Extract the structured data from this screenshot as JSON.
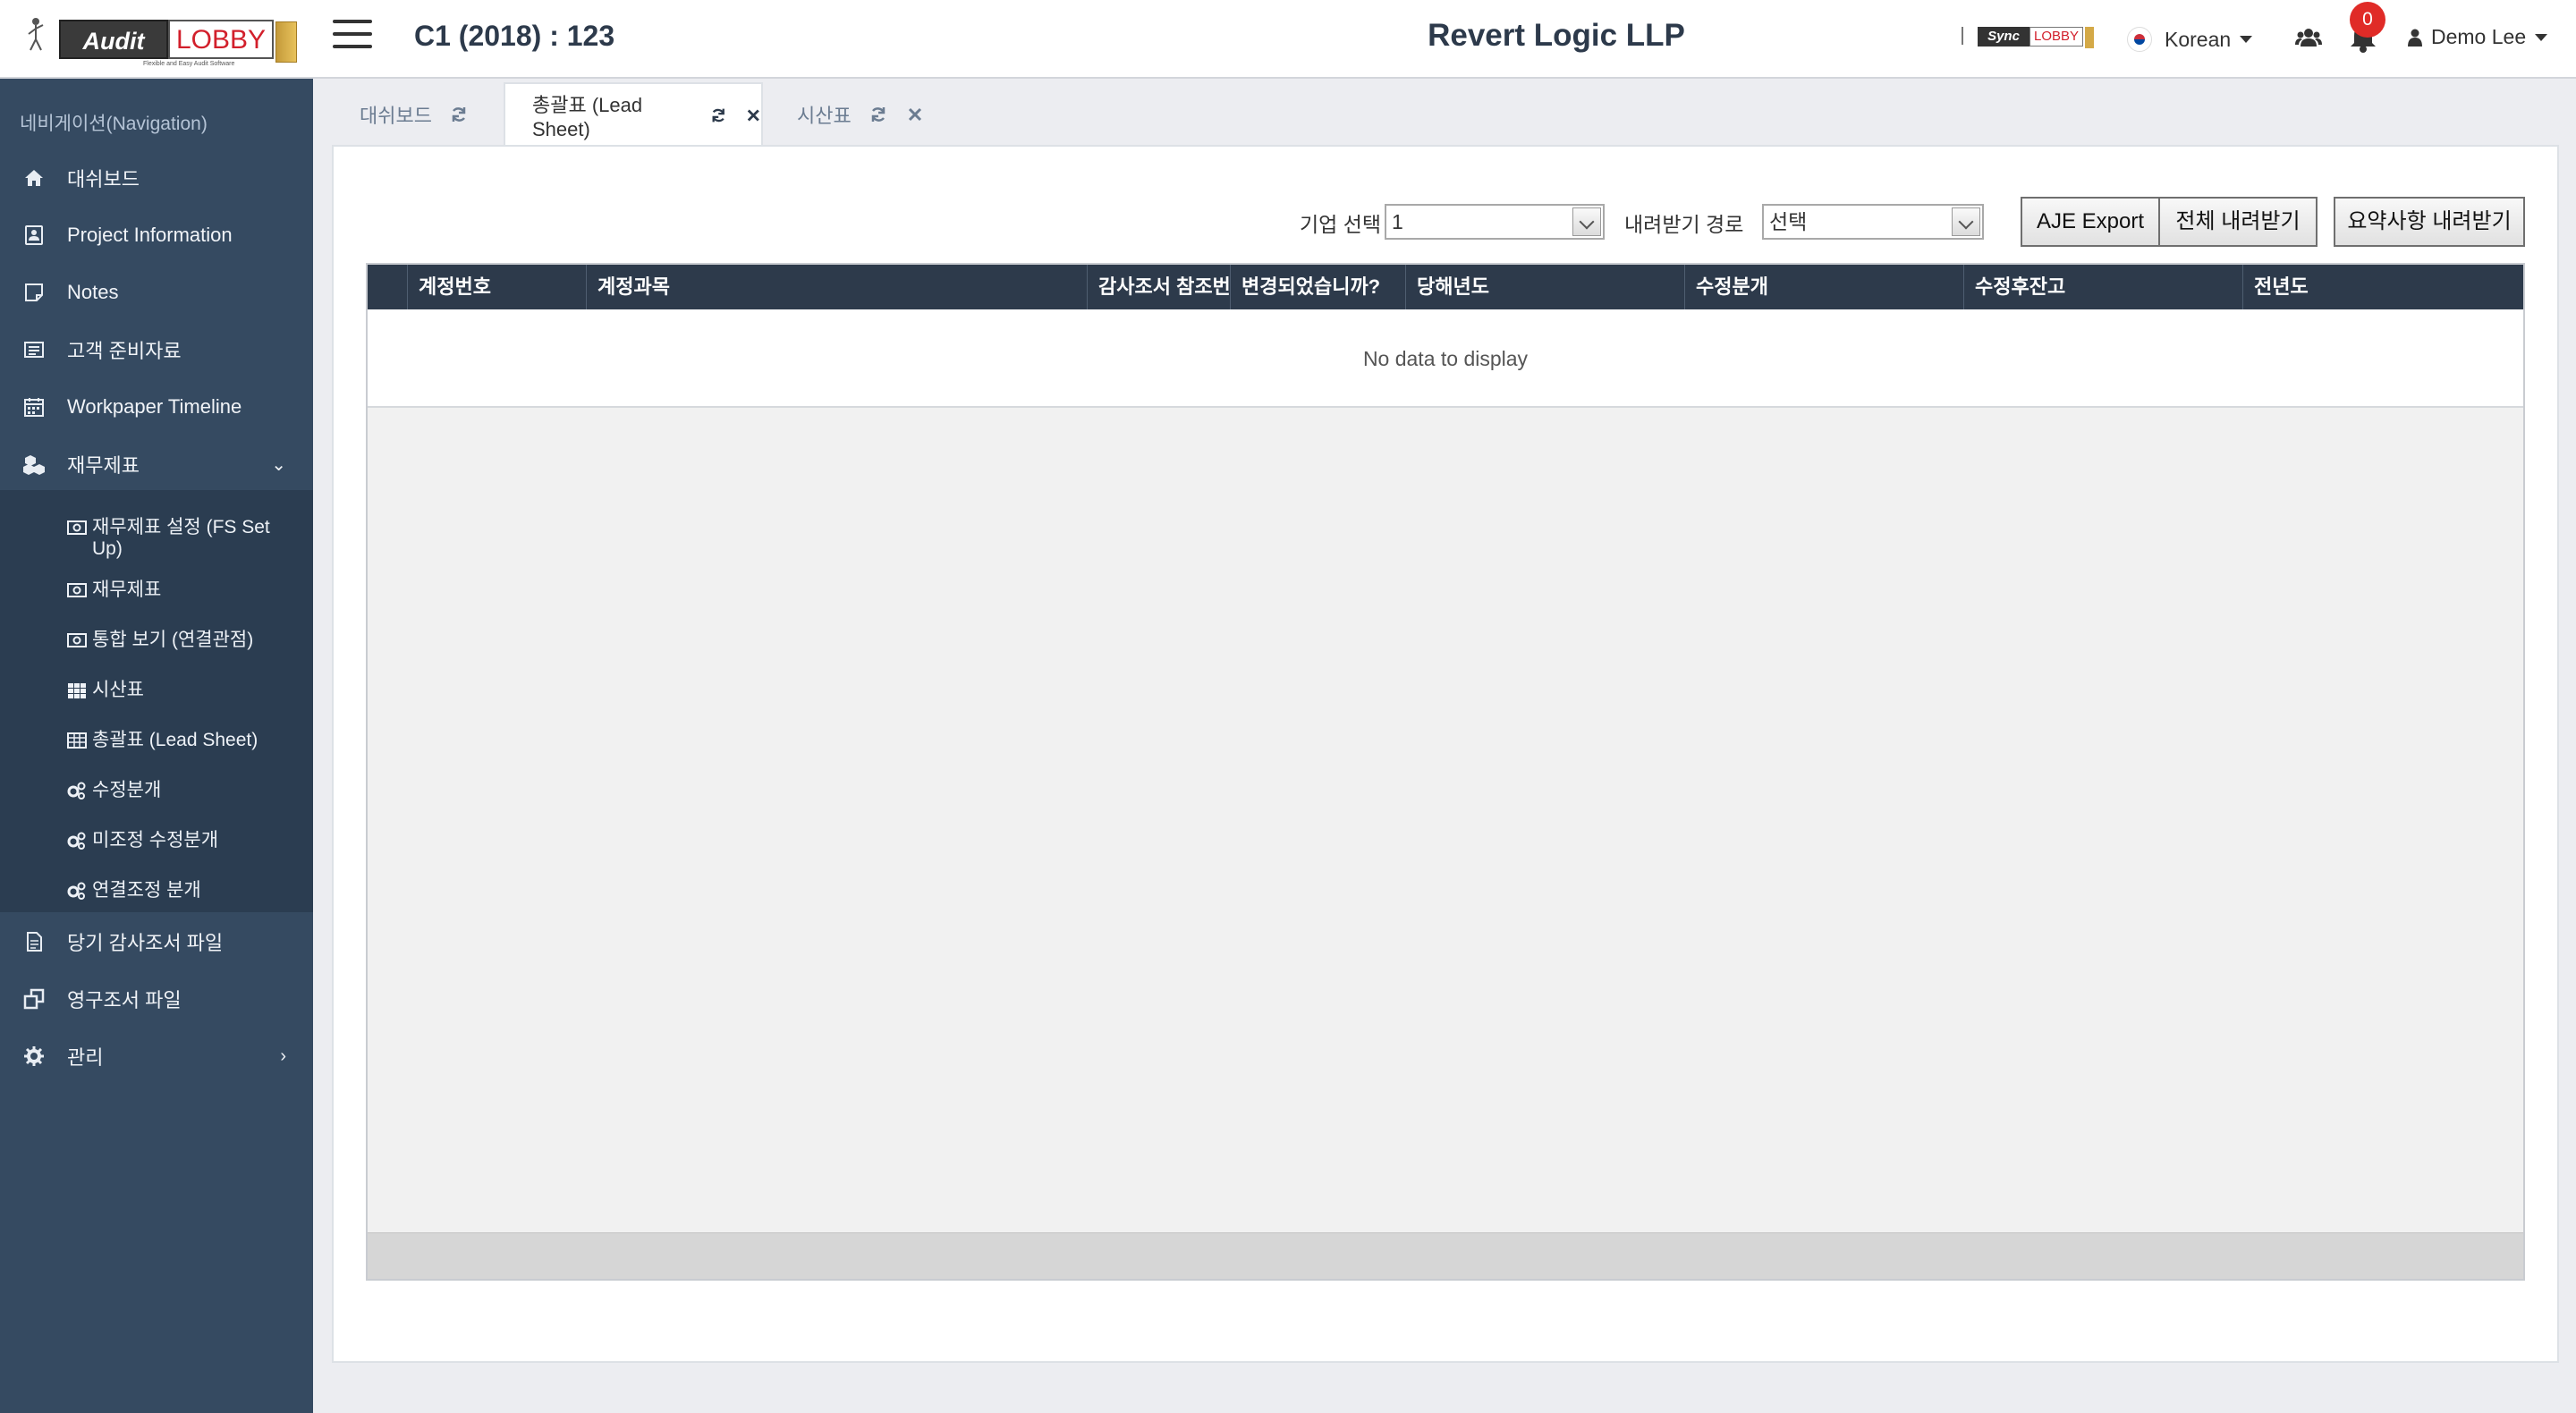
{
  "header": {
    "logo_audit": "Audit",
    "logo_lobby": "LOBBY",
    "logo_tagline": "Flexible and Easy Audit Software",
    "project_title": "C1 (2018) : 123",
    "company_title": "Revert Logic LLP",
    "sync_logo_a": "Sync",
    "sync_logo_b": "LOBBY",
    "language": "Korean",
    "notification_count": "0",
    "user_name": "Demo Lee"
  },
  "sidebar": {
    "nav_header": "네비게이션(Navigation)",
    "items": [
      {
        "label": "대쉬보드",
        "icon": "home-icon"
      },
      {
        "label": "Project Information",
        "icon": "info-icon"
      },
      {
        "label": "Notes",
        "icon": "note-icon"
      },
      {
        "label": "고객 준비자료",
        "icon": "list-icon"
      },
      {
        "label": "Workpaper Timeline",
        "icon": "calendar-icon"
      },
      {
        "label": "재무제표",
        "icon": "cubes-icon"
      },
      {
        "label": "당기 감사조서 파일",
        "icon": "file-icon"
      },
      {
        "label": "영구조서 파일",
        "icon": "clone-icon"
      },
      {
        "label": "관리",
        "icon": "gear-icon"
      }
    ],
    "sub_items": [
      {
        "label": "재무제표 설정 (FS Set Up)",
        "icon": "money-icon"
      },
      {
        "label": "재무제표",
        "icon": "money-icon"
      },
      {
        "label": "통합 보기 (연결관점)",
        "icon": "money-icon"
      },
      {
        "label": "시산표",
        "icon": "grid-icon"
      },
      {
        "label": "총괄표 (Lead Sheet)",
        "icon": "table-icon"
      },
      {
        "label": "수정분개",
        "icon": "cogs-icon"
      },
      {
        "label": "미조정 수정분개",
        "icon": "cogs-icon"
      },
      {
        "label": "연결조정 분개",
        "icon": "cogs-icon"
      }
    ]
  },
  "tabs": [
    {
      "label": "대쉬보드"
    },
    {
      "label": "총괄표 (Lead Sheet)"
    },
    {
      "label": "시산표"
    }
  ],
  "toolbar": {
    "company_select_label": "기업 선택",
    "company_select_value": "1",
    "download_path_label": "내려받기 경로",
    "download_path_value": "선택",
    "aje_export": "AJE Export",
    "download_all": "전체 내려받기",
    "download_summary": "요약사항 내려받기"
  },
  "grid": {
    "columns": [
      "계정번호",
      "계정과목",
      "감사조서 참조번호",
      "변경되었습니까?",
      "당해년도",
      "수정분개",
      "수정후잔고",
      "전년도"
    ],
    "empty_message": "No data to display"
  },
  "colors": {
    "sidebar_bg": "#354a61",
    "submenu_bg": "#2b3d51",
    "grid_header_bg": "#2d3a4b",
    "badge_red": "#e02b27",
    "lobby_red": "#d21f2b"
  }
}
